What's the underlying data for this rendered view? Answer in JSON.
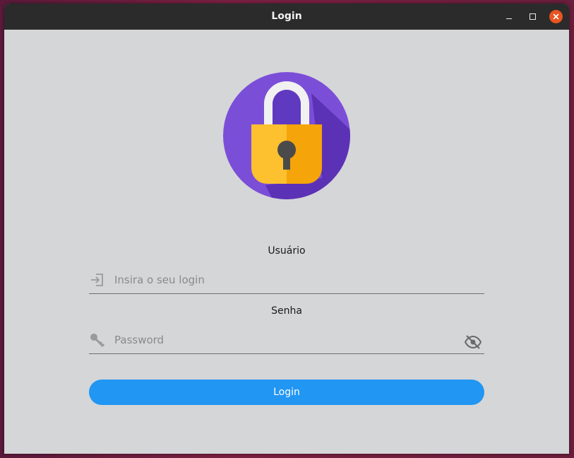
{
  "window": {
    "title": "Login",
    "controls": {
      "minimize": "minimize",
      "maximize": "maximize",
      "close": "close"
    }
  },
  "form": {
    "username_label": "Usuário",
    "username_placeholder": "Insira o seu login",
    "password_label": "Senha",
    "password_placeholder": "Password",
    "submit_label": "Login"
  },
  "colors": {
    "accent": "#2196f3",
    "close_button": "#e95420",
    "lock_background": "#7b4ed8",
    "lock_body": "#fbb82a"
  }
}
